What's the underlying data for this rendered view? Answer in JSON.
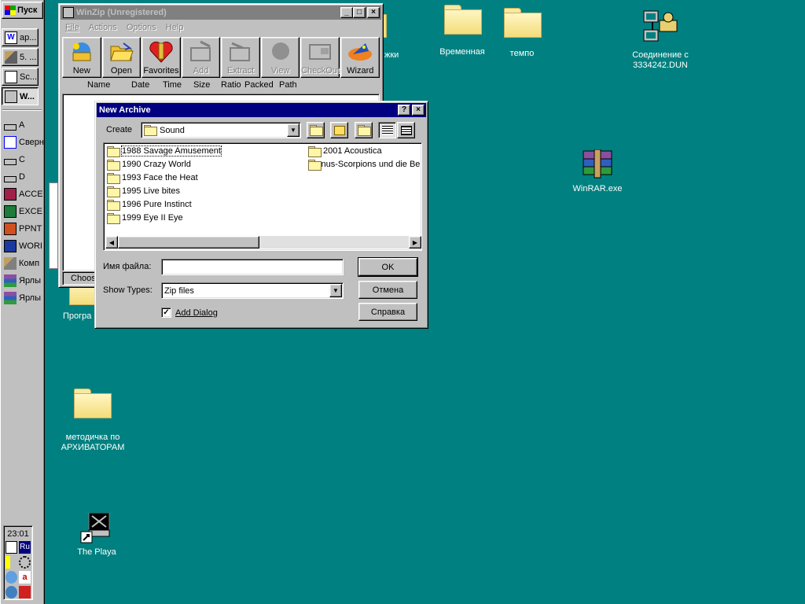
{
  "taskbar": {
    "start_label": "Пуск",
    "tasks": [
      {
        "label": "ар...",
        "icon": "word-doc-icon"
      },
      {
        "label": "5. ...",
        "icon": "tool-icon"
      },
      {
        "label": "Sc...",
        "icon": "scandisk-icon"
      },
      {
        "label": "W...",
        "icon": "winzip-icon"
      }
    ],
    "quick_launch": [
      {
        "label": "A",
        "icon": "drive-icon"
      },
      {
        "label": "Сверн",
        "icon": "minimize-all-icon"
      },
      {
        "label": "C",
        "icon": "drive-icon"
      },
      {
        "label": "D",
        "icon": "drive-icon"
      },
      {
        "label": "ACCE",
        "icon": "access-icon"
      },
      {
        "label": "EXCE",
        "icon": "excel-icon"
      },
      {
        "label": "PPNT",
        "icon": "powerpoint-icon"
      },
      {
        "label": "WORI",
        "icon": "word-icon"
      },
      {
        "label": "Комп",
        "icon": "computer-icon"
      },
      {
        "label": "Ярлы",
        "icon": "winrar-icon"
      },
      {
        "label": "Ярлы",
        "icon": "winrar-icon"
      }
    ],
    "clock": "23:01",
    "lang": "Ru"
  },
  "desktop": {
    "icons": [
      {
        "label": "Временная",
        "type": "folder"
      },
      {
        "label": "темпо",
        "type": "folder"
      },
      {
        "label": "Соединение с 3334242.DUN",
        "type": "dialup"
      },
      {
        "label": "WinRAR.exe",
        "type": "winrar"
      },
      {
        "label": "методичка по АРХИВАТОРАМ",
        "type": "folder"
      },
      {
        "label": "The Playa",
        "type": "shortcut"
      },
      {
        "label": "Програ",
        "type": "folder"
      },
      {
        "label": "жки",
        "type": "folder"
      }
    ]
  },
  "winzip": {
    "title": "WinZip (Unregistered)",
    "menu": [
      "File",
      "Actions",
      "Options",
      "Help"
    ],
    "toolbar": [
      {
        "label": "New",
        "enabled": true,
        "icon": "new-archive-icon"
      },
      {
        "label": "Open",
        "enabled": true,
        "icon": "open-folder-icon"
      },
      {
        "label": "Favorites",
        "enabled": true,
        "icon": "favorites-icon"
      },
      {
        "label": "Add",
        "enabled": false,
        "icon": "add-icon"
      },
      {
        "label": "Extract",
        "enabled": false,
        "icon": "extract-icon"
      },
      {
        "label": "View",
        "enabled": false,
        "icon": "view-icon"
      },
      {
        "label": "CheckOut",
        "enabled": false,
        "icon": "checkout-icon"
      },
      {
        "label": "Wizard",
        "enabled": true,
        "icon": "wizard-icon"
      }
    ],
    "columns": [
      "Name",
      "Date",
      "Time",
      "Size",
      "Ratio",
      "Packed",
      "Path"
    ],
    "status": "Choose"
  },
  "dialog": {
    "title": "New Archive",
    "create_label": "Create",
    "location": "Sound",
    "folders_left": [
      "1988 Savage Amusement",
      "1990 Crazy World",
      "1993 Face the Heat",
      "1995 Live bites",
      "1996 Pure Instinct",
      "1999 Eye II Eye"
    ],
    "folders_right": [
      "2001 Acoustica",
      "Bonus-Scorpions und die Be"
    ],
    "filename_label": "Имя файла:",
    "filename_value": "",
    "show_types_label": "Show Types:",
    "show_types_value": "Zip files",
    "add_dialog_label": "Add Dialog",
    "add_dialog_checked": true,
    "ok_label": "OK",
    "cancel_label": "Отмена",
    "help_label": "Справка"
  }
}
